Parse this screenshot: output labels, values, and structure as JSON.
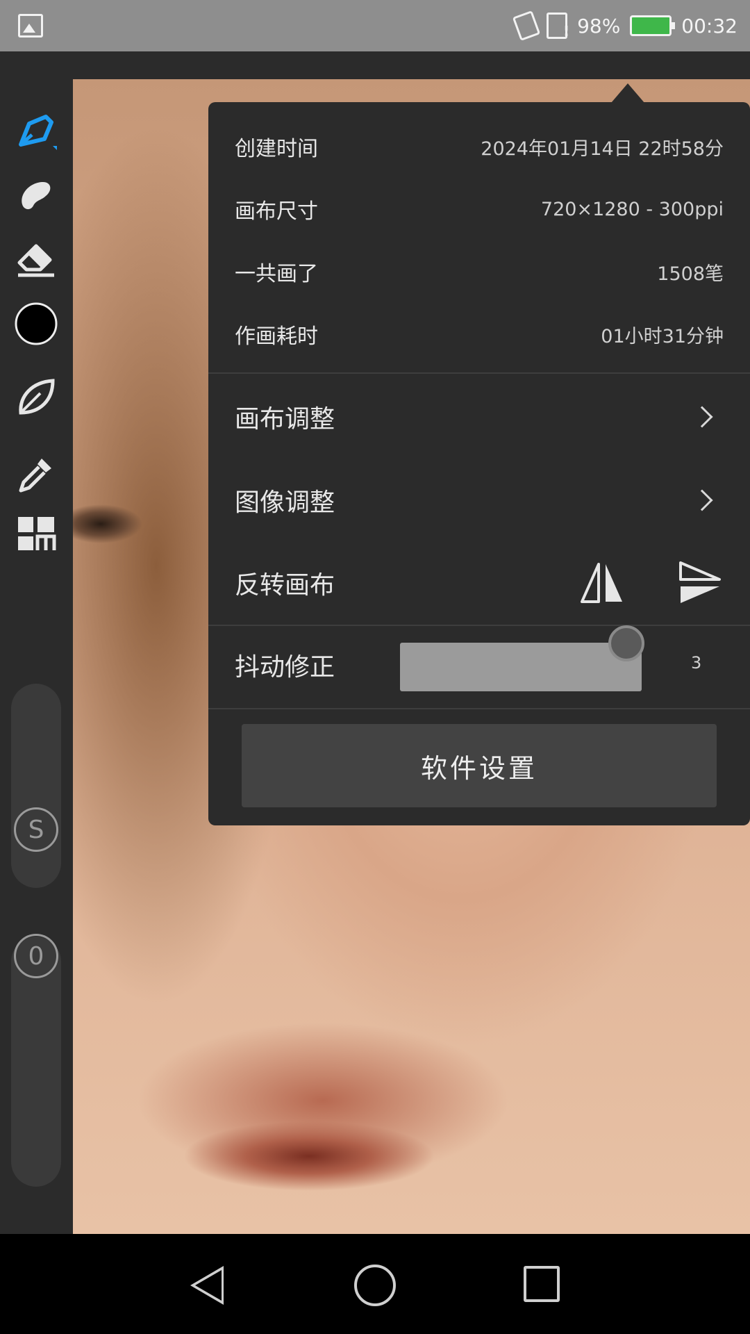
{
  "status_bar": {
    "battery_percent": "98%",
    "time": "00:32",
    "icons": [
      "gallery-icon",
      "vibrate-icon",
      "sim-alert-icon",
      "battery-charging-icon"
    ],
    "battery_color": "#3fb74a"
  },
  "toolbar": {
    "tools": [
      "brush-icon",
      "smudge-icon",
      "eraser-icon",
      "color-swatch",
      "leaf-brush-icon",
      "eyedropper-icon",
      "layers-grid-icon"
    ],
    "active_tool": "brush-icon",
    "accent_color": "#1e9bf0",
    "current_color": "#000000",
    "size_button": "S",
    "opacity_button": "0"
  },
  "info_panel": {
    "created_label": "创建时间",
    "created_value": "2024年01月14日 22时58分",
    "canvas_size_label": "画布尺寸",
    "canvas_size_value": "720×1280 - 300ppi",
    "strokes_label": "一共画了",
    "strokes_value": "1508笔",
    "duration_label": "作画耗时",
    "duration_value": "01小时31分钟",
    "canvas_adjust_label": "画布调整",
    "image_adjust_label": "图像调整",
    "flip_canvas_label": "反转画布",
    "stabilizer_label": "抖动修正",
    "stabilizer_value": "3",
    "software_settings_label": "软件设置"
  },
  "nav_bar": {
    "icons": [
      "back-icon",
      "home-icon",
      "recent-apps-icon"
    ]
  }
}
